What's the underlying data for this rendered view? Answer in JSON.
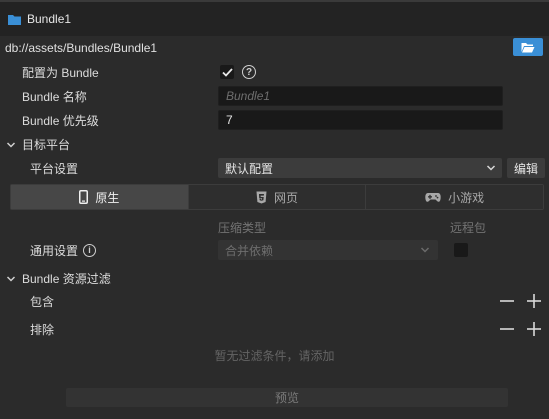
{
  "window": {
    "title": "Bundle1"
  },
  "path": {
    "value": "db://assets/Bundles/Bundle1"
  },
  "props": {
    "is_bundle_label": "配置为 Bundle",
    "is_bundle_checked": true,
    "name_label": "Bundle 名称",
    "name_placeholder": "Bundle1",
    "priority_label": "Bundle 优先级",
    "priority_value": "7"
  },
  "target": {
    "section_label": "目标平台",
    "platform_label": "平台设置",
    "platform_value": "默认配置",
    "edit_label": "编辑",
    "tabs": [
      {
        "label": "原生",
        "icon": "phone-icon",
        "active": true
      },
      {
        "label": "网页",
        "icon": "html5-icon",
        "active": false
      },
      {
        "label": "小游戏",
        "icon": "gamepad-icon",
        "active": false
      }
    ],
    "col_compression": "压缩类型",
    "col_remote": "远程包",
    "general_label": "通用设置",
    "compression_value": "合并依赖",
    "remote_checked": false
  },
  "filter": {
    "section_label": "Bundle 资源过滤",
    "include_label": "包含",
    "exclude_label": "排除",
    "empty_note": "暂无过滤条件，请添加"
  },
  "footer": {
    "preview_label": "预览"
  },
  "colors": {
    "accent": "#3a8fd6",
    "bg": "#2b2b2b",
    "field": "#191919"
  }
}
